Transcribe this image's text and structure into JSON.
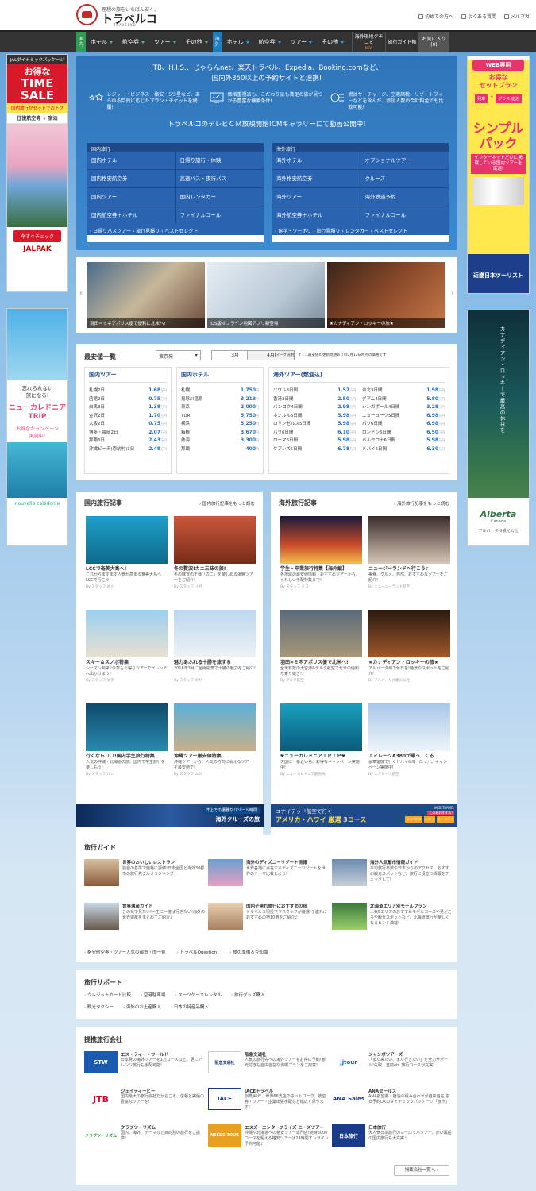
{
  "header": {
    "tagline": "理想の旅をいちばん安く。",
    "logo": "トラベルコ",
    "logo_sub": "TRAVELKO",
    "links": [
      "初めての方へ",
      "よくある質問",
      "メルマガ"
    ]
  },
  "nav": {
    "domestic_badge": "国内",
    "domestic": [
      "ホテル",
      "航空券",
      "ツアー",
      "その他"
    ],
    "overseas_badge": "海外",
    "overseas": [
      "ホテル",
      "航空券",
      "ツアー",
      "その他"
    ],
    "kuchikomi": "海外現地クチコミ",
    "kuchikomi_badge": "NEW",
    "guide": "旅行ガイド帳",
    "fav": "お気に入り",
    "fav_count": "(0)"
  },
  "ads": {
    "jal": {
      "top": "JALダイナミックパッケージ",
      "deal": "お得な",
      "sale1": "TIME",
      "sale2": "SALE",
      "sub": "国内旅行がセットでおトク",
      "air": "往復航空券",
      "plus": "+",
      "stay": "宿泊",
      "btn": "今すぐチェック",
      "brand": "JALPAK"
    },
    "nc": {
      "msg1": "忘れられない",
      "msg2": "旅になる!",
      "title1": "ニューカレドニア",
      "title2": "TRIP",
      "camp1": "お得なキャンペーン",
      "camp2": "実施中!",
      "brand": "nouvelle calédonie"
    },
    "kinki": {
      "web": "WEB専用",
      "deal1": "お得な",
      "deal2": "セットプラン",
      "train": "列車",
      "plus": "+",
      "stay": "プラス 宿泊",
      "big1": "シンプル",
      "big2": "パック",
      "sub": "インターネットだけに掲載している国内ツアーを厳選!",
      "brand": "近畿日本ツーリスト"
    },
    "alberta": {
      "vert": "カナディアン・ロッキーで最高の休日を",
      "brand": "Alberta",
      "country": "Canada",
      "credit": "アルバータ州観光公社",
      "photo": "Travel Alberta / Paul Zizka"
    }
  },
  "promo": {
    "line1": "JTB、H.I.S.、じゃらんnet、楽天トラベル、Expedia、Booking.comなど、",
    "line2": "国内外350以上の予約サイトと連携!",
    "features": [
      "レジャー・ビジネス・格安・5つ星など、あらゆる目的に応じたプラン・チケットを網羅!",
      "価格重視派も、こだわり派も満足の旅が見つかる豊富な検索条件!",
      "燃油サーチャージ、空港諸税、リゾートフィーなどを含んだ、参加人数の合計料金でも比較可能!"
    ],
    "cm": "トラベルコのテレビＣＭ放映開始!CMギャラリーにて動画公開中!",
    "domestic": {
      "head": "国内旅行",
      "items": [
        "国内ホテル",
        "日帰り旅行・体験",
        "国内格安航空券",
        "高速バス・夜行バス",
        "国内ツアー",
        "国内レンタカー",
        "国内航空券＋ホテル",
        "ファイナルコール"
      ],
      "sub": "› 日帰りバスツアー › 旅行見積り › ベストセレクト"
    },
    "overseas": {
      "head": "海外旅行",
      "items": [
        "海外ホテル",
        "オプショナルツアー",
        "海外格安航空券",
        "クルーズ",
        "海外ツアー",
        "海外鉄道予約",
        "海外航空券＋ホテル",
        "ファイナルコール"
      ],
      "sub": "› 留学・ワーホリ › 旅行見積り › レンタカー › ベストセレクト"
    }
  },
  "carousel": {
    "slides": [
      "羽田＝ミネアポリス便で便利に北米へ!",
      "iOS版オフライン地図アプリ新登場",
      "★カナディアン・ロッキーの旅★"
    ]
  },
  "prices": {
    "title": "最安値一覧",
    "origin": "東京発",
    "months": [
      "3月",
      "4月"
    ],
    "note": "【マーク説明】 ↑↓…最安値の更新問題ありの2月12日時点の価格です",
    "unit": "万円",
    "yen_unit": "円",
    "domestic_tour": {
      "title": "国内ツアー",
      "rows": [
        [
          "札幌2日",
          "1.68"
        ],
        [
          "函館2日",
          "0.75"
        ],
        [
          "白馬3日",
          "1.38"
        ],
        [
          "金沢2日",
          "1.70"
        ],
        [
          "大阪2日",
          "0.75"
        ],
        [
          "博多・福岡2日",
          "2.07"
        ],
        [
          "那覇3日",
          "2.43"
        ],
        [
          "沖縄ビーチ(恩納村)3日",
          "2.48"
        ]
      ]
    },
    "domestic_hotel": {
      "title": "国内ホテル",
      "rows": [
        [
          "札幌",
          "1,750"
        ],
        [
          "鬼怒川温泉",
          "3,213"
        ],
        [
          "東京",
          "2,000"
        ],
        [
          "TDR",
          "5,750"
        ],
        [
          "横浜",
          "5,250"
        ],
        [
          "箱根",
          "3,670"
        ],
        [
          "熱海",
          "3,300"
        ],
        [
          "那覇",
          "400"
        ]
      ]
    },
    "overseas_tour": {
      "title": "海外ツアー(燃油込)",
      "left": [
        [
          "ソウル3日間",
          "1.57"
        ],
        [
          "香港3日間",
          "2.50"
        ],
        [
          "バンコク4日間",
          "2.98"
        ],
        [
          "ホノルル5日間",
          "5.98"
        ],
        [
          "ロサンゼルス5日間",
          "5.98"
        ],
        [
          "バリ6日間",
          "6.10"
        ],
        [
          "ローマ6日間",
          "5.98"
        ],
        [
          "ケアンズ5日間",
          "6.78"
        ]
      ],
      "right": [
        [
          "台北3日間",
          "1.98"
        ],
        [
          "グアム4日間",
          "5.80"
        ],
        [
          "シンガポール4日間",
          "3.28"
        ],
        [
          "ニューヨーク5日間",
          "6.98"
        ],
        [
          "パリ6日間",
          "6.98"
        ],
        [
          "ロンドン6日間",
          "6.50"
        ],
        [
          "バルセロナ6日間",
          "5.98"
        ],
        [
          "ドバイ6日間",
          "6.30"
        ]
      ]
    }
  },
  "domestic_articles": {
    "title": "国内旅行記事",
    "more": "国内旅行記事をもっと読む",
    "items": [
      {
        "title": "LCCで奄美大島へ!",
        "desc": "これからますます人気が高まる奄美大島へLCCで行こう!",
        "by": "By スタッフ めぐ"
      },
      {
        "title": "冬の贅沢!カニ三昧の旅!",
        "desc": "冬の味覚の王様「カニ」を楽しめる海鮮ツアーをご紹介!",
        "by": "By スタッフ イガ"
      },
      {
        "title": "スキー＆スノボ特集",
        "desc": "シーズン到来♪今季もお得なツアーでゲレンデへ出かけよう!",
        "by": "By スタッフ ゆき"
      },
      {
        "title": "魅力あふれる十勝を旅する",
        "desc": "2016年3月に全線開業で十勝の魅力をご紹介!",
        "by": "By スタッフ のり"
      },
      {
        "title": "行くならココ!国内学生旅行特集",
        "desc": "人気の沖縄・北海道の旅。国内で学生旅行を楽しもう!",
        "by": "By スタッフ けい"
      },
      {
        "title": "沖縄ツアー厳安値特集",
        "desc": "沖縄ツアーから、人気の方向に会えるツアーを最安値で!",
        "by": "By スタッフ ムメ"
      }
    ]
  },
  "overseas_articles": {
    "title": "海外旅行記事",
    "more": "海外旅行記事をもっと読む",
    "items": [
      {
        "title": "学生・卒業旅行特集【海外編】",
        "desc": "各地域の最安値情報・おすすめツアーから、うれしい手配特集まで!",
        "by": "By スタッフ チコ"
      },
      {
        "title": "ニュージーランドへ行こう♪",
        "desc": "美食、グルメ、自然、おすすめなツアーをご紹介!",
        "by": "By ニュージーランド航空"
      },
      {
        "title": "羽田=ミネアポリス便で北米へ!",
        "desc": "全米有数の大空港&デルタ航空で北米の便利な乗り継ぎ!",
        "by": "By デルタ航空"
      },
      {
        "title": "★カナディアン・ロッキーの旅★",
        "desc": "アルバータ州で休日を!絶景やスポットをご紹介!",
        "by": "By アルバータ州観光公社"
      },
      {
        "title": "❤ニューカレドニアＴＲＩＰ❤",
        "desc": "天国に一番近い島、お得なキャンペーン実施中!",
        "by": "By ニューカレドニア観光局"
      },
      {
        "title": "エミレーツA380が帰ってくる",
        "desc": "豪華客機で行くドバイ&ヨーロッパ。キャンペーン実施中!",
        "by": "By エミレーツ航空"
      }
    ]
  },
  "banners": {
    "cruise1": "洋上での優雅なリゾート時間",
    "cruise2": "海外クルーズの旅",
    "united1": "ユナイテッド航空で行く",
    "united2": "アメリカ・ハワイ 厳選 3コース",
    "united_tag": "この春おすすめ!",
    "united_brand": "IACE TRAVEL",
    "cities": [
      "ラスベガス",
      "ハワイ",
      "オーランド"
    ]
  },
  "guide": {
    "title": "旅行ガイド",
    "items": [
      {
        "title": "世界のおいしいレストラン",
        "desc": "独自の基準で厳格に評価!日本全国と海外30都市の旅行先グルメランキング"
      },
      {
        "title": "海外のディズニーリゾート情報",
        "desc": "世界各地に点在するディズニーリゾートを世界のテーマ比較しよう!"
      },
      {
        "title": "海外人気都市情報ガイド",
        "desc": "平均旅行日数や日本からのアクセス、おすすめ観光スポットなど、旅行に役立つ情報をチェックして!"
      },
      {
        "title": "世界遺産ガイド",
        "desc": "この目で見たい!一生に一度は行きたい!海外の世界遺産をまとめてご紹介♪"
      },
      {
        "title": "国内子連れ旅行におすすめの宿",
        "desc": "トラベルコ現役ママスタッフが厳選!子連れにおすすめの宿10選をご紹介♪"
      },
      {
        "title": "北海道エリア別モデルプラン",
        "desc": "人気5エリアのおすすめモデルコースや見どころや観光スポットなど、北海道旅行が楽しくなるヒント満載!"
      }
    ],
    "links": [
      "格安航空券・ツアー人気の都市・国一覧",
      "トラベルQuestion!",
      "旅の準備＆豆知識"
    ]
  },
  "support": {
    "title": "旅行サポート",
    "row1": [
      "クレジットカード比較",
      "空港駐車場",
      "スーツケースレンタル",
      "旅行グッズ購入"
    ],
    "row2": [
      "観光タクシー",
      "海外のお土産購入",
      "日本の特産品購入"
    ]
  },
  "partners": {
    "title": "提携旅行会社",
    "all": "掲載会社一覧へ",
    "items": [
      {
        "logo": "STW",
        "name": "エス・ティー・ワールド",
        "desc": "日本発の海外ツアーを1万コース以上。更にアレンジ旅行も手配可能!"
      },
      {
        "logo": "阪急交通社",
        "name": "阪急交通社",
        "desc": "人気の旅行先への海外ツアーをお得に予約!観光付きも自由自在な満喫プランをご用意!"
      },
      {
        "logo": "jjtour",
        "name": "ジャンボツアーズ",
        "desc": "「また来たい、また行きたい」を全力サポート!先取・直前etc.旅行コースが充実!"
      },
      {
        "logo": "JTB",
        "name": "ジェイティービー",
        "desc": "国内最大の旅行会社だからこそ、信頼と実績の豊富なツアーを!"
      },
      {
        "logo": "IACE",
        "name": "IACEトラベル",
        "desc": "創業46年、世界66支店のネットワーク。航空券・ツアー・企業出張手配など幅広く承ります!"
      },
      {
        "logo": "ANA Sales",
        "name": "ANAセールス",
        "desc": "ANA航空券・宿泊の組み合わせが自由自在!前日予約OKのダイナミックパッケージ「旅作」"
      },
      {
        "logo": "クラブツーリズム",
        "name": "クラブツーリズム",
        "desc": "国内、海外、テーマなど目的別の旅行をご提供!"
      },
      {
        "logo": "NEEDS TOUR",
        "name": "エヌズ・エンタープライズ ニーズツアー",
        "desc": "沖縄や北海道への格安ツアー専門店!随時5000コースを超える格安ツアーは24時間オンライン予約可能♪"
      },
      {
        "logo": "日本旅行",
        "name": "日本旅行",
        "desc": "大人気日本旅行のヨーロッパツアー、赤い風船の国内旅行も大充実♪"
      }
    ]
  }
}
